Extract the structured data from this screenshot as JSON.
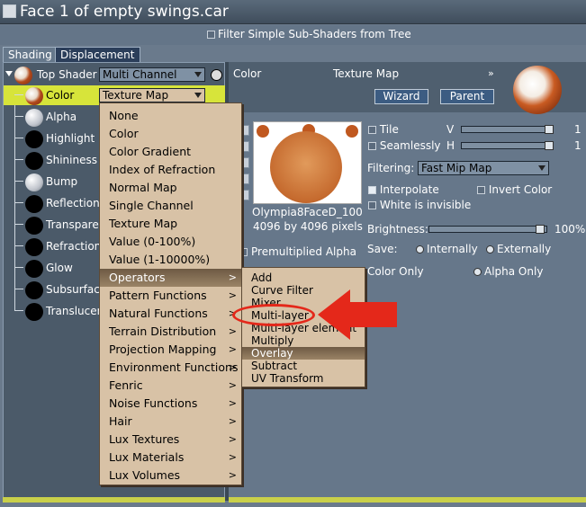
{
  "window": {
    "title": "Face 1 of empty swings.car"
  },
  "filter_bar": {
    "label": "Filter Simple Sub-Shaders from Tree",
    "checked": false
  },
  "tabs": [
    {
      "label": "Shading",
      "active": true
    },
    {
      "label": "Displacement",
      "active": false
    }
  ],
  "tree": {
    "top": {
      "label": "Top Shader",
      "value": "Multi Channel"
    },
    "channels": [
      {
        "label": "Color",
        "value": "Texture Map",
        "selected": true
      },
      {
        "label": "Alpha"
      },
      {
        "label": "Highlight"
      },
      {
        "label": "Shininess"
      },
      {
        "label": "Bump"
      },
      {
        "label": "Reflection"
      },
      {
        "label": "Transparer"
      },
      {
        "label": "Refraction"
      },
      {
        "label": "Glow"
      },
      {
        "label": "Subsurface"
      },
      {
        "label": "Translucen"
      }
    ]
  },
  "right": {
    "header_color": "Color",
    "header_type": "Texture Map",
    "header_dropdown": "»",
    "wizard_label": "Wizard",
    "parent_label": "Parent",
    "image_name": "Olympia8FaceD_100",
    "image_size": "4096 by 4096 pixels",
    "premultiplied": "Premultiplied Alpha",
    "tile": "Tile",
    "seamlessly": "Seamlessly",
    "v_label": "V",
    "h_label": "H",
    "v_value": "1",
    "h_value": "1",
    "filtering_label": "Filtering:",
    "filtering_value": "Fast Mip Map",
    "interpolate": "Interpolate",
    "invert": "Invert Color",
    "white_invisible": "White is invisible",
    "brightness_label": "Brightness:",
    "brightness_value": "100%",
    "save_label": "Save:",
    "internally": "Internally",
    "externally": "Externally",
    "color_only": "Color Only",
    "alpha_only": "Alpha Only"
  },
  "menu_main": [
    {
      "label": "None"
    },
    {
      "label": "Color"
    },
    {
      "label": "Color Gradient"
    },
    {
      "label": "Index of Refraction"
    },
    {
      "label": "Normal Map"
    },
    {
      "label": "Single Channel"
    },
    {
      "label": "Texture Map"
    },
    {
      "label": "Value (0-100%)"
    },
    {
      "label": "Value (1-10000%)"
    },
    {
      "label": "Operators",
      "sub": ">",
      "highlighted": true
    },
    {
      "label": "Pattern Functions",
      "sub": ">"
    },
    {
      "label": "Natural Functions",
      "sub": ">"
    },
    {
      "label": "Terrain Distribution",
      "sub": ">"
    },
    {
      "label": "Projection Mapping",
      "sub": ">"
    },
    {
      "label": "Environment Functions",
      "sub": ">"
    },
    {
      "label": "Fenric",
      "sub": ">"
    },
    {
      "label": "Noise Functions",
      "sub": ">"
    },
    {
      "label": "Hair",
      "sub": ">"
    },
    {
      "label": "Lux Textures",
      "sub": ">"
    },
    {
      "label": "Lux Materials",
      "sub": ">"
    },
    {
      "label": "Lux Volumes",
      "sub": ">"
    }
  ],
  "menu_ops": [
    {
      "label": "Add"
    },
    {
      "label": "Curve Filter"
    },
    {
      "label": "Mixer"
    },
    {
      "label": "Multi-layer"
    },
    {
      "label": "Multi-layer element"
    },
    {
      "label": "Multiply"
    },
    {
      "label": "Overlay",
      "highlighted": true
    },
    {
      "label": "Subtract"
    },
    {
      "label": "UV Transform"
    }
  ],
  "colors": {
    "highlight_row": "#d7e43a",
    "menu_bg": "#d8c2a6",
    "annotation": "#e4281a"
  }
}
